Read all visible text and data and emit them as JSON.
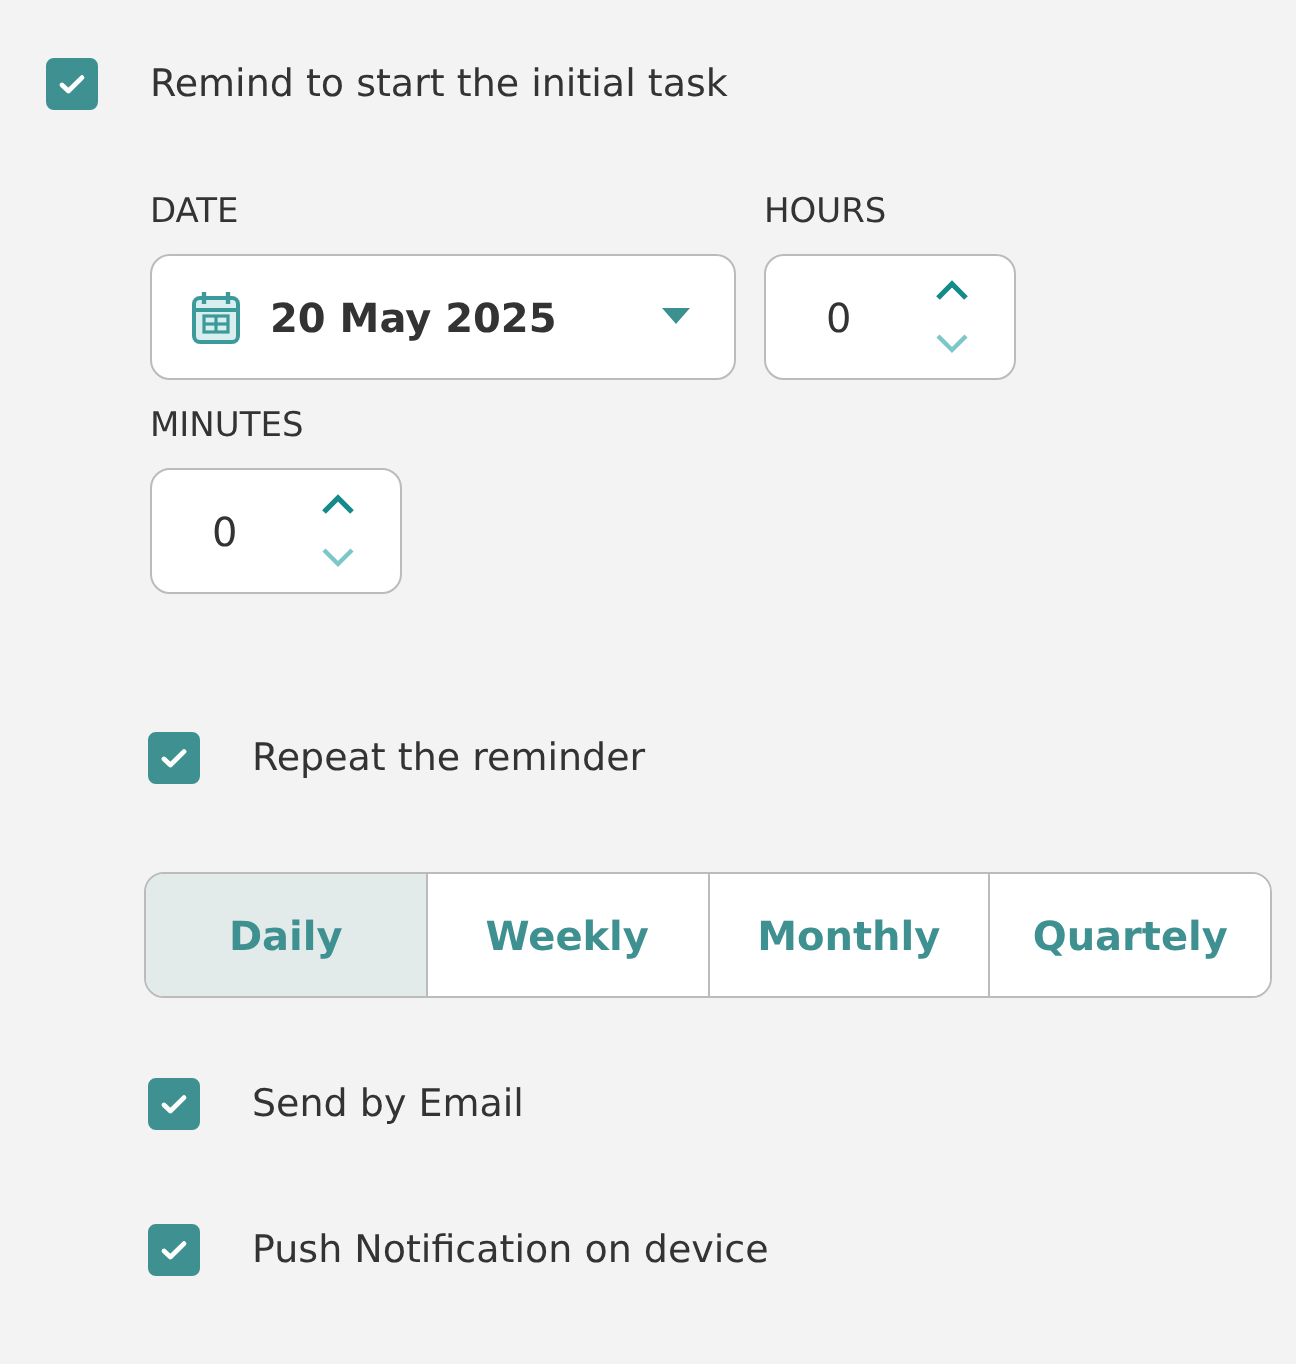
{
  "main_option": {
    "label": "Remind to start the initial task",
    "checked": true
  },
  "date": {
    "label": "DATE",
    "value": "20 May 2025"
  },
  "hours": {
    "label": "HOURS",
    "value": "0"
  },
  "minutes": {
    "label": "MINUTES",
    "value": "0"
  },
  "repeat": {
    "label": "Repeat the reminder",
    "checked": true
  },
  "frequency": [
    {
      "label": "Daily",
      "selected": true
    },
    {
      "label": "Weekly",
      "selected": false
    },
    {
      "label": "Monthly",
      "selected": false
    },
    {
      "label": "Quartely",
      "selected": false
    }
  ],
  "channels": [
    {
      "label": "Send by Email",
      "checked": true
    },
    {
      "label": "Push Notification on device",
      "checked": true
    }
  ]
}
